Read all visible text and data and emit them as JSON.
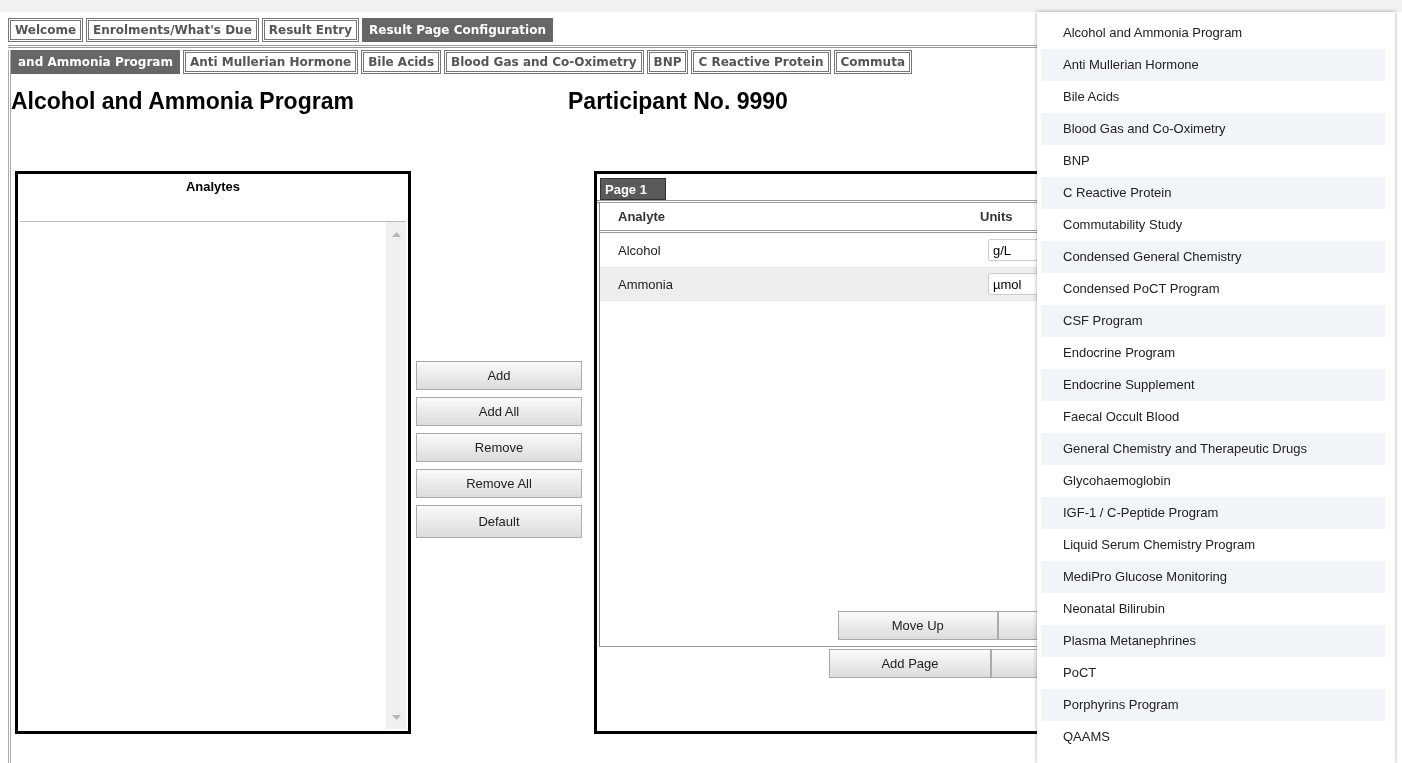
{
  "top_tabs": [
    {
      "label": "Welcome",
      "selected": false
    },
    {
      "label": "Enrolments/What's Due",
      "selected": false
    },
    {
      "label": "Result Entry",
      "selected": false
    },
    {
      "label": "Result Page Configuration",
      "selected": true
    }
  ],
  "program_tabs": [
    {
      "label": "and Ammonia Program",
      "selected": true
    },
    {
      "label": "Anti Mullerian Hormone",
      "selected": false
    },
    {
      "label": "Bile Acids",
      "selected": false
    },
    {
      "label": "Blood Gas and Co-Oximetry",
      "selected": false
    },
    {
      "label": "BNP",
      "selected": false
    },
    {
      "label": "C Reactive Protein",
      "selected": false
    },
    {
      "label": "Commuta",
      "selected": false
    }
  ],
  "title": "Alcohol and Ammonia Program",
  "participant": "Participant No. 9990",
  "analytes_panel": {
    "title": "Analytes"
  },
  "buttons": [
    "Add",
    "Add All",
    "Remove",
    "Remove All",
    "Default"
  ],
  "page_panel": {
    "tabs": [
      {
        "label": "Page 1",
        "selected": true
      }
    ],
    "columns": [
      "Analyte",
      "Units"
    ],
    "rows": [
      {
        "analyte": "Alcohol",
        "units": "g/L",
        "selected": false
      },
      {
        "analyte": "Ammonia",
        "units": "µmol",
        "selected": true
      }
    ],
    "move_buttons": [
      "Move Up"
    ],
    "page_buttons": [
      "Add Page"
    ]
  },
  "dropdown": {
    "items": [
      "Alcohol and Ammonia Program",
      "Anti Mullerian Hormone",
      "Bile Acids",
      "Blood Gas and Co-Oximetry",
      "BNP",
      "C Reactive Protein",
      "Commutability Study",
      "Condensed General Chemistry",
      "Condensed PoCT Program",
      "CSF Program",
      "Endocrine Program",
      "Endocrine Supplement",
      "Faecal Occult Blood",
      "General Chemistry and Therapeutic Drugs",
      "Glycohaemoglobin",
      "IGF-1 / C-Peptide Program",
      "Liquid Serum Chemistry Program",
      "MediPro Glucose Monitoring",
      "Neonatal Bilirubin",
      "Plasma Metanephrines",
      "PoCT",
      "Porphyrins Program",
      "QAAMS"
    ]
  }
}
